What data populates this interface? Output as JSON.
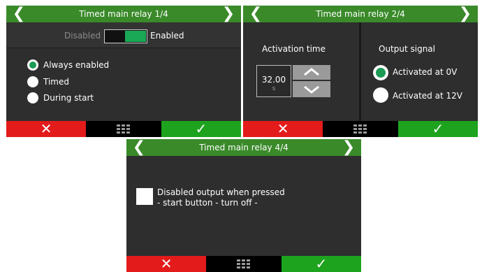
{
  "panel1": {
    "title": "Timed main relay 1/4",
    "toggle": {
      "off_label": "Disabled",
      "on_label": "Enabled",
      "state": "enabled"
    },
    "options": [
      {
        "label": "Always enabled",
        "selected": true
      },
      {
        "label": "Timed",
        "selected": false
      },
      {
        "label": "During start",
        "selected": false
      }
    ]
  },
  "panel2": {
    "title": "Timed main relay 2/4",
    "activation": {
      "heading": "Activation time",
      "value": "32.00",
      "unit": "s"
    },
    "output": {
      "heading": "Output signal",
      "options": [
        {
          "label": "Activated at 0V",
          "selected": true
        },
        {
          "label": "Activated at 12V",
          "selected": false
        }
      ]
    }
  },
  "panel3": {
    "title": "Timed main relay 4/4",
    "checkbox": {
      "line1": "Disabled output when pressed",
      "line2": "- start button - turn off -",
      "checked": false
    }
  },
  "icons": {
    "prev": "chevron-left-icon",
    "next": "chevron-right-icon",
    "cancel": "close-icon",
    "menu": "grid-icon",
    "confirm": "check-icon",
    "up": "chevron-up-icon",
    "down": "chevron-down-icon"
  },
  "colors": {
    "title_green": "#3a8a2a",
    "cancel_red": "#e31b1b",
    "confirm_green": "#1ea31e",
    "panel_bg": "#2e2e2e",
    "radio_selected": "#1a9a55"
  }
}
